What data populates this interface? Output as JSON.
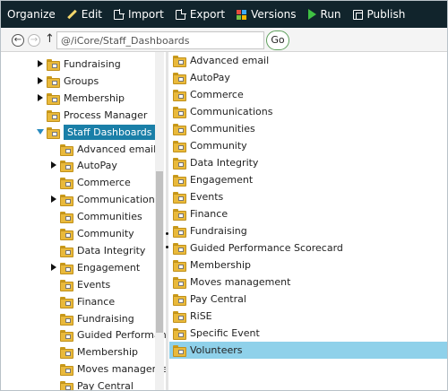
{
  "toolbar": {
    "buttons": [
      {
        "label": "Organize",
        "icon": "none"
      },
      {
        "label": "Edit",
        "icon": "pencil-icon"
      },
      {
        "label": "Import",
        "icon": "document-icon"
      },
      {
        "label": "Export",
        "icon": "document-icon"
      },
      {
        "label": "Versions",
        "icon": "grid-icon"
      },
      {
        "label": "Run",
        "icon": "play-icon"
      },
      {
        "label": "Publish",
        "icon": "publish-icon"
      }
    ]
  },
  "address": {
    "back_glyph": "←",
    "forward_glyph": "→",
    "up_glyph": "↑",
    "path": "@/iCore/Staff_Dashboards",
    "go_label": "Go"
  },
  "tree": {
    "items": [
      {
        "label": "Fundraising",
        "level": 0,
        "state": "collapsed"
      },
      {
        "label": "Groups",
        "level": 0,
        "state": "collapsed"
      },
      {
        "label": "Membership",
        "level": 0,
        "state": "collapsed"
      },
      {
        "label": "Process Manager",
        "level": 0,
        "state": "leaf"
      },
      {
        "label": "Staff Dashboards",
        "level": 0,
        "state": "expanded",
        "selected": true
      },
      {
        "label": "Advanced email",
        "level": 1,
        "state": "leaf"
      },
      {
        "label": "AutoPay",
        "level": 1,
        "state": "collapsed"
      },
      {
        "label": "Commerce",
        "level": 1,
        "state": "leaf"
      },
      {
        "label": "Communications",
        "level": 1,
        "state": "collapsed"
      },
      {
        "label": "Communities",
        "level": 1,
        "state": "leaf"
      },
      {
        "label": "Community",
        "level": 1,
        "state": "leaf"
      },
      {
        "label": "Data Integrity",
        "level": 1,
        "state": "leaf"
      },
      {
        "label": "Engagement",
        "level": 1,
        "state": "collapsed"
      },
      {
        "label": "Events",
        "level": 1,
        "state": "leaf"
      },
      {
        "label": "Finance",
        "level": 1,
        "state": "leaf"
      },
      {
        "label": "Fundraising",
        "level": 1,
        "state": "leaf"
      },
      {
        "label": "Guided Performance S",
        "level": 1,
        "state": "leaf"
      },
      {
        "label": "Membership",
        "level": 1,
        "state": "leaf"
      },
      {
        "label": "Moves management",
        "level": 1,
        "state": "leaf"
      },
      {
        "label": "Pay Central",
        "level": 1,
        "state": "leaf"
      }
    ]
  },
  "list": {
    "items": [
      {
        "label": "Advanced email"
      },
      {
        "label": "AutoPay"
      },
      {
        "label": "Commerce"
      },
      {
        "label": "Communications"
      },
      {
        "label": "Communities"
      },
      {
        "label": "Community"
      },
      {
        "label": "Data Integrity"
      },
      {
        "label": "Engagement"
      },
      {
        "label": "Events"
      },
      {
        "label": "Finance"
      },
      {
        "label": "Fundraising"
      },
      {
        "label": "Guided Performance Scorecard"
      },
      {
        "label": "Membership"
      },
      {
        "label": "Moves management"
      },
      {
        "label": "Pay Central"
      },
      {
        "label": "RiSE"
      },
      {
        "label": "Specific Event"
      },
      {
        "label": "Volunteers",
        "selected": true
      }
    ]
  },
  "colors": {
    "toolbar_bg": "#11242c",
    "selected_tree": "#1a7fa8",
    "selected_list": "#8fd1ea",
    "folder": "#e9b93b",
    "run_icon": "#3fc043"
  }
}
